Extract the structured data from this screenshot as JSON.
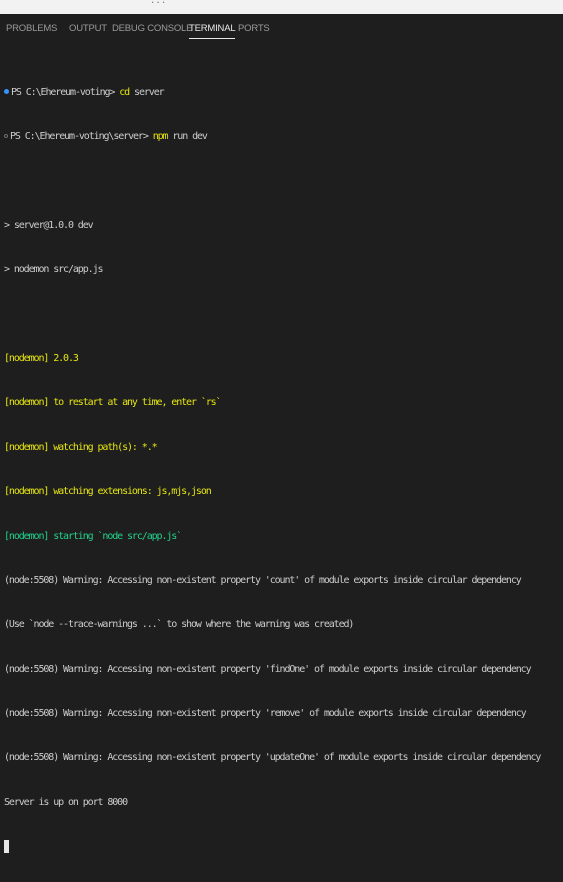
{
  "colors": {
    "background": "#1e1e1e",
    "text": "#cccccc",
    "yellow": "#e5e510",
    "green": "#23d18b",
    "dot_blue": "#3794ff"
  },
  "top_fragment": "...",
  "tabs": [
    {
      "label": "PROBLEMS",
      "active": false
    },
    {
      "label": "OUTPUT",
      "active": false
    },
    {
      "label": "DEBUG CONSOLE",
      "active": false
    },
    {
      "label": "TERMINAL",
      "active": true
    },
    {
      "label": "PORTS",
      "active": false
    }
  ],
  "terminal": {
    "prompt1": "PS C:\\Ehereum-voting> ",
    "cmd1_a": "cd",
    "cmd1_b": " server",
    "prompt2": "PS C:\\Ehereum-voting\\server> ",
    "cmd2_a": "npm",
    "cmd2_b": " run dev",
    "script_lines": [
      "> server@1.0.0 dev",
      "> nodemon src/app.js"
    ],
    "nodemon_lines": [
      "[nodemon] 2.0.3",
      "[nodemon] to restart at any time, enter `rs`",
      "[nodemon] watching path(s): *.*",
      "[nodemon] watching extensions: js,mjs,json"
    ],
    "nodemon_start": "[nodemon] starting `node src/app.js`",
    "output_lines": [
      "(node:5508) Warning: Accessing non-existent property 'count' of module exports inside circular dependency",
      "(Use `node --trace-warnings ...` to show where the warning was created)",
      "(node:5508) Warning: Accessing non-existent property 'findOne' of module exports inside circular dependency",
      "(node:5508) Warning: Accessing non-existent property 'remove' of module exports inside circular dependency",
      "(node:5508) Warning: Accessing non-existent property 'updateOne' of module exports inside circular dependency",
      "Server is up on port 8000"
    ]
  }
}
